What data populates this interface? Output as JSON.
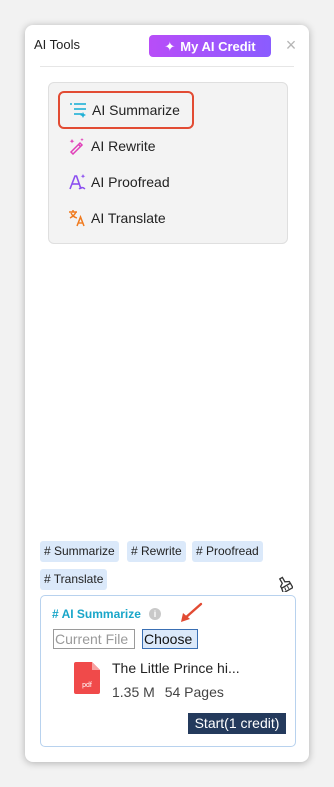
{
  "header": {
    "title": "AI Tools",
    "credit_label": "My AI Credit",
    "close_glyph": "×"
  },
  "menu": {
    "items": [
      {
        "label": "AI Summarize",
        "icon": "summarize-icon",
        "selected": true
      },
      {
        "label": "AI Rewrite",
        "icon": "rewrite-icon",
        "selected": false
      },
      {
        "label": "AI Proofread",
        "icon": "proofread-icon",
        "selected": false
      },
      {
        "label": "AI Translate",
        "icon": "translate-icon",
        "selected": false
      }
    ]
  },
  "tags": [
    "# Summarize",
    "# Rewrite",
    "# Proofread",
    "# Translate"
  ],
  "task": {
    "title": "# AI Summarize",
    "info_glyph": "i",
    "current_file_label": "Current File",
    "choose_label": "Choose",
    "file_name": "The Little Prince hi...",
    "file_size": "1.35 M",
    "file_pages": "54 Pages",
    "start_label": "Start(1 credit)"
  },
  "colors": {
    "credit_gradient_start": "#b84df8",
    "credit_gradient_end": "#8a5cff",
    "selection_border": "#e24b33",
    "tag_bg": "#dbe9fa",
    "task_title": "#19a6c9",
    "start_bg": "#243a5c",
    "pdf_red": "#f04a4a"
  }
}
